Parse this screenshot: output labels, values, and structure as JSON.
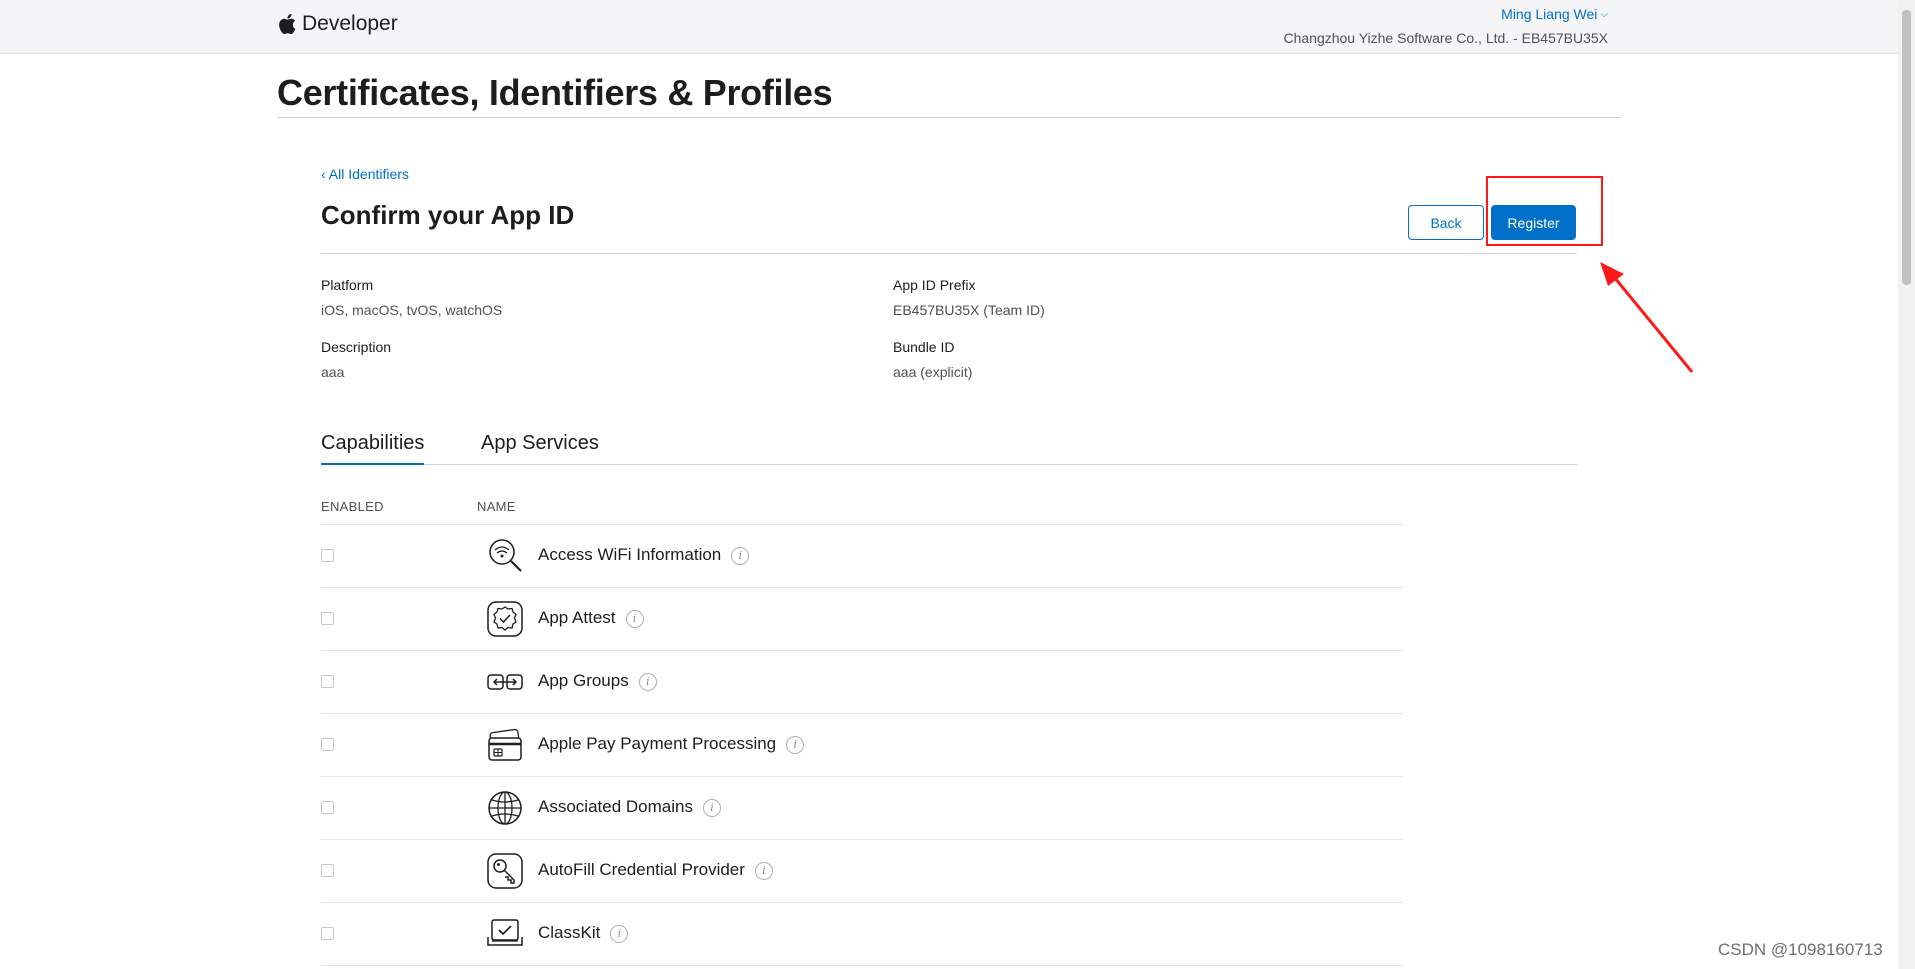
{
  "header": {
    "brand": "Developer",
    "user": "Ming Liang Wei",
    "team": "Changzhou Yizhe Software Co., Ltd. - EB457BU35X"
  },
  "page_title": "Certificates, Identifiers & Profiles",
  "back_link": "‹ All Identifiers",
  "section_title": "Confirm your App ID",
  "buttons": {
    "back": "Back",
    "register": "Register"
  },
  "fields": {
    "platform": {
      "label": "Platform",
      "value": "iOS, macOS, tvOS, watchOS"
    },
    "prefix": {
      "label": "App ID Prefix",
      "value": "EB457BU35X (Team ID)"
    },
    "description": {
      "label": "Description",
      "value": "aaa"
    },
    "bundle": {
      "label": "Bundle ID",
      "value": "aaa (explicit)"
    }
  },
  "tabs": [
    "Capabilities",
    "App Services"
  ],
  "columns": {
    "enabled": "ENABLED",
    "name": "NAME"
  },
  "capabilities": [
    {
      "name": "Access WiFi Information",
      "icon": "wifi-search-icon",
      "enabled": false
    },
    {
      "name": "App Attest",
      "icon": "badge-check-icon",
      "enabled": false
    },
    {
      "name": "App Groups",
      "icon": "app-groups-icon",
      "enabled": false
    },
    {
      "name": "Apple Pay Payment Processing",
      "icon": "credit-card-icon",
      "enabled": false
    },
    {
      "name": "Associated Domains",
      "icon": "globe-icon",
      "enabled": false
    },
    {
      "name": "AutoFill Credential Provider",
      "icon": "key-icon",
      "enabled": false
    },
    {
      "name": "ClassKit",
      "icon": "classkit-icon",
      "enabled": false
    }
  ],
  "info_glyph": "i",
  "watermark": "CSDN @1098160713",
  "colors": {
    "accent": "#0070c9",
    "highlight": "#ff1a1a"
  }
}
